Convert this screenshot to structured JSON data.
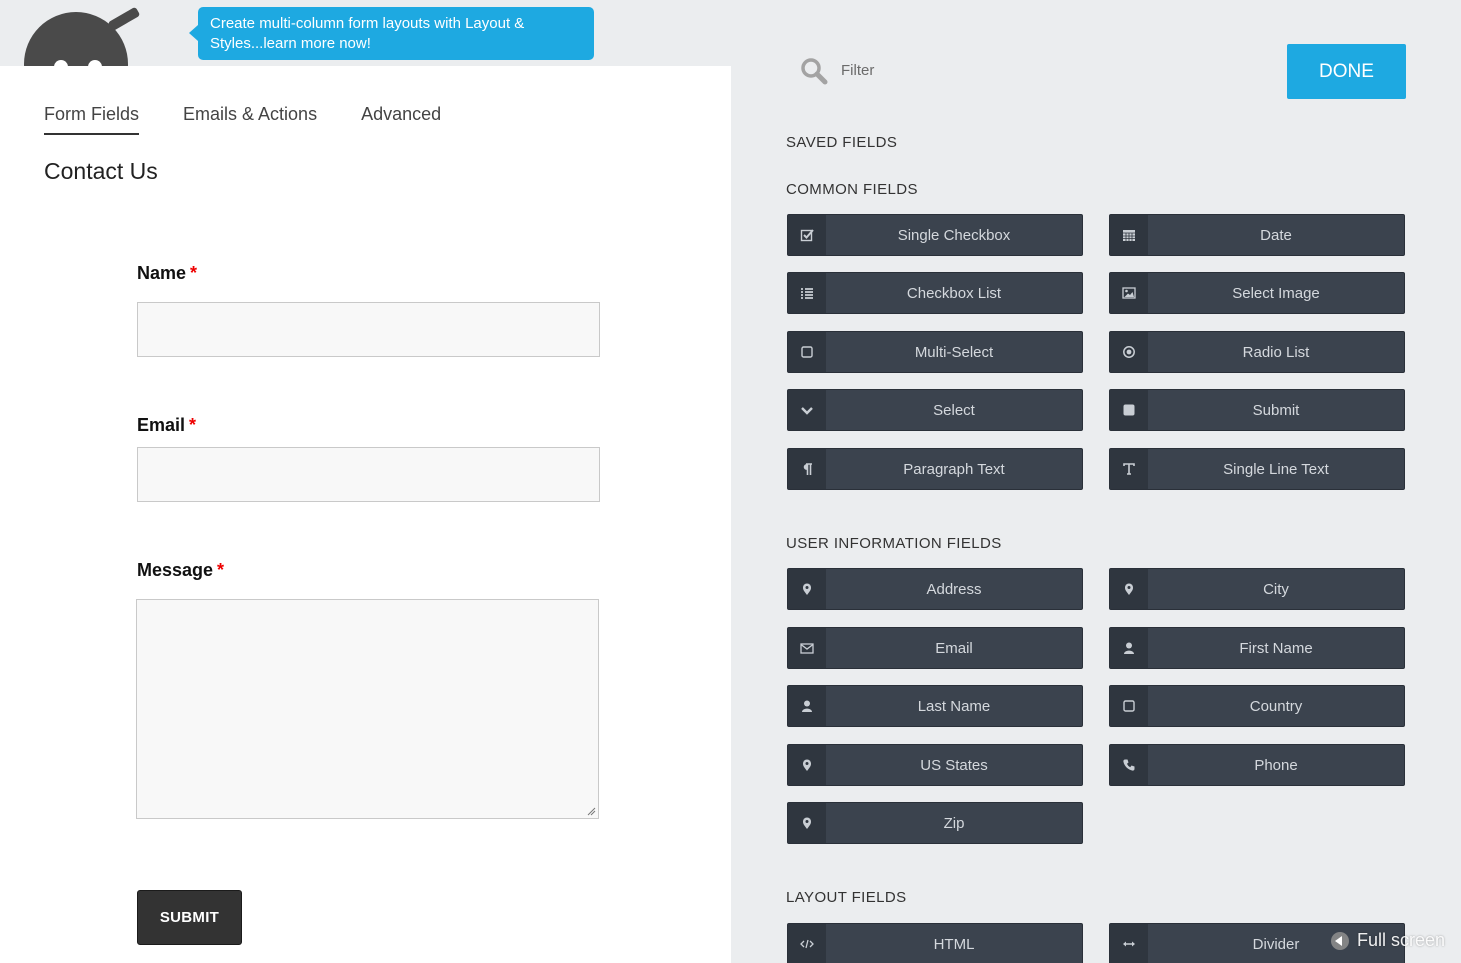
{
  "banner": {
    "text": "Create multi-column form layouts with Layout & Styles...learn more now!"
  },
  "tabs": [
    {
      "label": "Form Fields",
      "active": true
    },
    {
      "label": "Emails & Actions",
      "active": false
    },
    {
      "label": "Advanced",
      "active": false
    }
  ],
  "form": {
    "title": "Contact Us",
    "fields": [
      {
        "label": "Name",
        "required": "*",
        "value": ""
      },
      {
        "label": "Email",
        "required": "*",
        "value": ""
      },
      {
        "label": "Message",
        "required": "*",
        "value": ""
      }
    ],
    "submit_label": "SUBMIT"
  },
  "fields_panel": {
    "filter_placeholder": "Filter",
    "done_label": "DONE",
    "sections": {
      "saved": "SAVED FIELDS",
      "common": "COMMON FIELDS",
      "user_info": "USER INFORMATION FIELDS",
      "layout": "LAYOUT FIELDS"
    },
    "common": [
      {
        "label": "Single Checkbox",
        "icon": "check-square-icon"
      },
      {
        "label": "Date",
        "icon": "calendar-icon"
      },
      {
        "label": "Checkbox List",
        "icon": "list-icon"
      },
      {
        "label": "Select Image",
        "icon": "image-icon"
      },
      {
        "label": "Multi-Select",
        "icon": "square-outline-icon"
      },
      {
        "label": "Radio List",
        "icon": "radio-dot-icon"
      },
      {
        "label": "Select",
        "icon": "chevron-down-icon"
      },
      {
        "label": "Submit",
        "icon": "square-filled-icon"
      },
      {
        "label": "Paragraph Text",
        "icon": "paragraph-icon"
      },
      {
        "label": "Single Line Text",
        "icon": "text-t-icon"
      }
    ],
    "user_info": [
      {
        "label": "Address",
        "icon": "map-marker-icon"
      },
      {
        "label": "City",
        "icon": "map-marker-icon"
      },
      {
        "label": "Email",
        "icon": "envelope-icon"
      },
      {
        "label": "First Name",
        "icon": "user-icon"
      },
      {
        "label": "Last Name",
        "icon": "user-icon"
      },
      {
        "label": "Country",
        "icon": "square-outline-icon"
      },
      {
        "label": "US States",
        "icon": "map-marker-icon"
      },
      {
        "label": "Phone",
        "icon": "phone-icon"
      },
      {
        "label": "Zip",
        "icon": "map-marker-icon"
      }
    ],
    "layout": [
      {
        "label": "HTML",
        "icon": "code-icon"
      },
      {
        "label": "Divider",
        "icon": "arrows-h-icon"
      }
    ]
  },
  "fullscreen_label": "Full screen"
}
